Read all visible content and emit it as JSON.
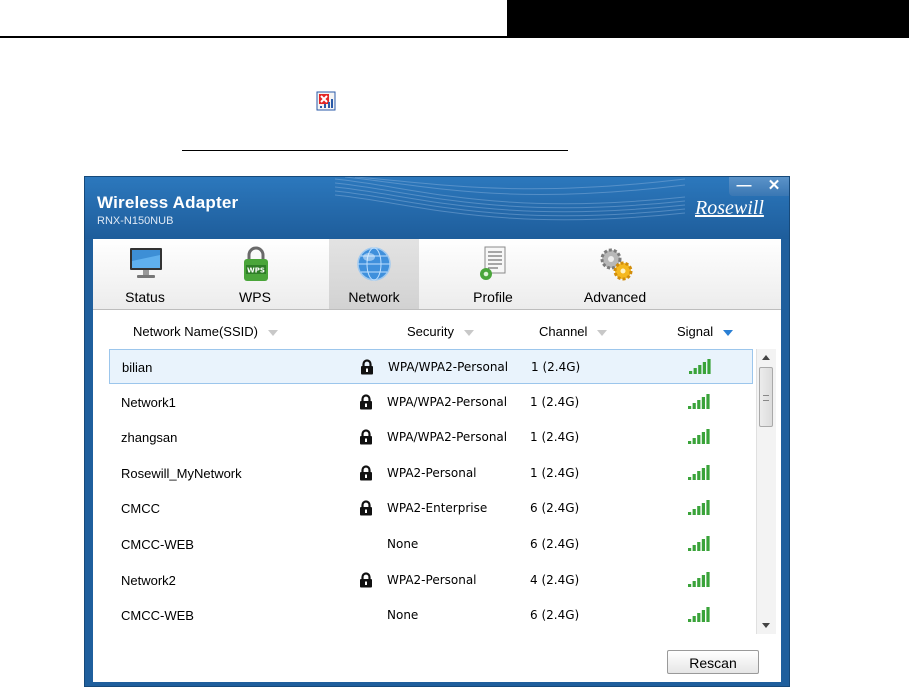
{
  "app": {
    "title": "Wireless Adapter",
    "model": "RNX-N150NUB",
    "brand": "Rosewill",
    "minimize_symbol": "—",
    "close_symbol": "✕"
  },
  "tabs": [
    {
      "label": "Status",
      "icon": "monitor-icon"
    },
    {
      "label": "WPS",
      "icon": "wps-lock-icon"
    },
    {
      "label": "Network",
      "icon": "globe-icon",
      "active": true
    },
    {
      "label": "Profile",
      "icon": "document-gear-icon"
    },
    {
      "label": "Advanced",
      "icon": "gears-icon"
    }
  ],
  "columns": {
    "ssid": "Network Name(SSID)",
    "security": "Security",
    "channel": "Channel",
    "signal": "Signal"
  },
  "networks": [
    {
      "ssid": "bilian",
      "security": "WPA/WPA2-Personal",
      "channel": "1 (2.4G)",
      "locked": true,
      "selected": true
    },
    {
      "ssid": "Network1",
      "security": "WPA/WPA2-Personal",
      "channel": "1 (2.4G)",
      "locked": true
    },
    {
      "ssid": "zhangsan",
      "security": "WPA/WPA2-Personal",
      "channel": "1 (2.4G)",
      "locked": true
    },
    {
      "ssid": "Rosewill_MyNetwork",
      "security": "WPA2-Personal",
      "channel": "1 (2.4G)",
      "locked": true
    },
    {
      "ssid": "CMCC",
      "security": "WPA2-Enterprise",
      "channel": "6 (2.4G)",
      "locked": true
    },
    {
      "ssid": "CMCC-WEB",
      "security": "None",
      "channel": "6 (2.4G)",
      "locked": false
    },
    {
      "ssid": "Network2",
      "security": "WPA2-Personal",
      "channel": "4 (2.4G)",
      "locked": true
    },
    {
      "ssid": "CMCC-WEB",
      "security": "None",
      "channel": "6 (2.4G)",
      "locked": false
    }
  ],
  "buttons": {
    "rescan": "Rescan"
  },
  "colors": {
    "title_bar": "#1e5d9b",
    "signal": "#3aa33a",
    "selection": "#e9f3fc",
    "sort_active": "#2a7fd4"
  }
}
